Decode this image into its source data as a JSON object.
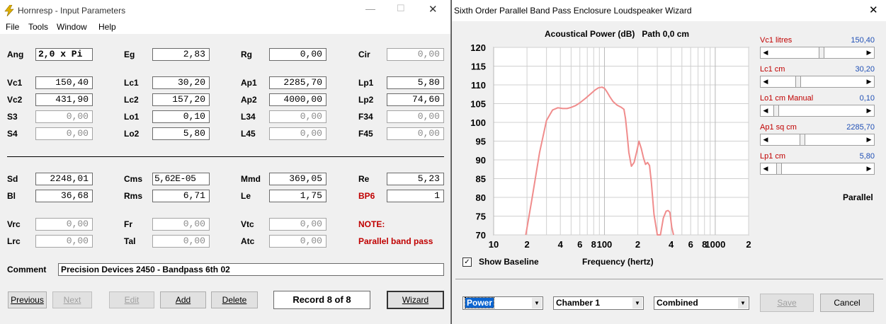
{
  "left_window": {
    "title": "Hornresp - Input Parameters",
    "menu": [
      "File",
      "Tools",
      "Window",
      "Help"
    ],
    "params": {
      "Ang": {
        "label": "Ang",
        "value": "2,0 x Pi"
      },
      "Eg": {
        "label": "Eg",
        "value": "2,83"
      },
      "Rg": {
        "label": "Rg",
        "value": "0,00"
      },
      "Cir": {
        "label": "Cir",
        "value": "0,00"
      },
      "Vc1": {
        "label": "Vc1",
        "value": "150,40"
      },
      "Lc1": {
        "label": "Lc1",
        "value": "30,20"
      },
      "Ap1": {
        "label": "Ap1",
        "value": "2285,70"
      },
      "Lp1": {
        "label": "Lp1",
        "value": "5,80"
      },
      "Vc2": {
        "label": "Vc2",
        "value": "431,90"
      },
      "Lc2": {
        "label": "Lc2",
        "value": "157,20"
      },
      "Ap2": {
        "label": "Ap2",
        "value": "4000,00"
      },
      "Lp2": {
        "label": "Lp2",
        "value": "74,60"
      },
      "S3": {
        "label": "S3",
        "value": "0,00"
      },
      "Lo1": {
        "label": "Lo1",
        "value": "0,10"
      },
      "L34": {
        "label": "L34",
        "value": "0,00"
      },
      "F34": {
        "label": "F34",
        "value": "0,00"
      },
      "S4": {
        "label": "S4",
        "value": "0,00"
      },
      "Lo2": {
        "label": "Lo2",
        "value": "5,80"
      },
      "L45": {
        "label": "L45",
        "value": "0,00"
      },
      "F45": {
        "label": "F45",
        "value": "0,00"
      },
      "Sd": {
        "label": "Sd",
        "value": "2248,01"
      },
      "Cms": {
        "label": "Cms",
        "value": "5,62E-05"
      },
      "Mmd": {
        "label": "Mmd",
        "value": "369,05"
      },
      "Re": {
        "label": "Re",
        "value": "5,23"
      },
      "Bl": {
        "label": "Bl",
        "value": "36,68"
      },
      "Rms": {
        "label": "Rms",
        "value": "6,71"
      },
      "Le": {
        "label": "Le",
        "value": "1,75"
      },
      "BP6": {
        "label": "BP6",
        "value": "1"
      },
      "Vrc": {
        "label": "Vrc",
        "value": "0,00"
      },
      "Fr": {
        "label": "Fr",
        "value": "0,00"
      },
      "Vtc": {
        "label": "Vtc",
        "value": "0,00"
      },
      "Lrc": {
        "label": "Lrc",
        "value": "0,00"
      },
      "Tal": {
        "label": "Tal",
        "value": "0,00"
      },
      "Atc": {
        "label": "Atc",
        "value": "0,00"
      }
    },
    "note_label": "NOTE:",
    "note_text": "Parallel band pass",
    "comment_label": "Comment",
    "comment_value": "Precision Devices 2450 - Bandpass 6th 02",
    "buttons": {
      "previous": "Previous",
      "next": "Next",
      "edit": "Edit",
      "add": "Add",
      "delete": "Delete",
      "wizard": "Wizard"
    },
    "record": "Record 8 of 8"
  },
  "right_window": {
    "title": "Sixth Order Parallel Band Pass Enclosure Loudspeaker Wizard",
    "close": "✕",
    "sliders": [
      {
        "label": "Vc1  litres",
        "value": "150,40"
      },
      {
        "label": "Lc1  cm",
        "value": "30,20"
      },
      {
        "label": "Lo1  cm  Manual",
        "value": "0,10"
      },
      {
        "label": "Ap1  sq cm",
        "value": "2285,70"
      },
      {
        "label": "Lp1  cm",
        "value": "5,80"
      }
    ],
    "parallel_label": "Parallel",
    "show_baseline": "Show Baseline",
    "show_baseline_checked": true,
    "selects": {
      "type": "Power",
      "chamber": "Chamber 1",
      "mode": "Combined"
    },
    "save": "Save",
    "cancel": "Cancel"
  },
  "chart_data": {
    "type": "line",
    "title": "Acoustical Power (dB)   Path 0,0 cm",
    "xlabel": "Frequency (hertz)",
    "ylabel": "",
    "xscale": "log",
    "xlim": [
      10,
      2000
    ],
    "ylim": [
      70,
      120
    ],
    "y_ticks": [
      70,
      75,
      80,
      85,
      90,
      95,
      100,
      105,
      110,
      115,
      120
    ],
    "x_tick_labels": [
      "10",
      "2",
      "4",
      "6",
      "8",
      "100",
      "2",
      "4",
      "6",
      "8",
      "1000",
      "2"
    ],
    "grid": true,
    "series_color": "#f08c8c",
    "series": [
      {
        "x": [
          19.5,
          22,
          26,
          30,
          34,
          38,
          42,
          46,
          50,
          55,
          60,
          68,
          75,
          82,
          88,
          95,
          100,
          105,
          112,
          120,
          130,
          142,
          150,
          155,
          160,
          166,
          175,
          185,
          195,
          205,
          215,
          225,
          235,
          245,
          255,
          265,
          280,
          300,
          320,
          340,
          360,
          375,
          390,
          405,
          420
        ],
        "y": [
          70,
          79,
          92,
          100.5,
          103.3,
          103.9,
          103.7,
          103.7,
          104,
          104.5,
          105.2,
          106.5,
          107.6,
          108.6,
          109.2,
          109.4,
          109.1,
          108.2,
          106.8,
          105.5,
          104.6,
          104,
          103.5,
          101,
          97,
          92,
          88.3,
          89.3,
          92,
          95,
          93,
          90.5,
          88.8,
          89.3,
          88.5,
          84,
          75.5,
          70,
          70,
          74.5,
          76.3,
          76.5,
          76,
          72,
          70
        ]
      }
    ]
  }
}
